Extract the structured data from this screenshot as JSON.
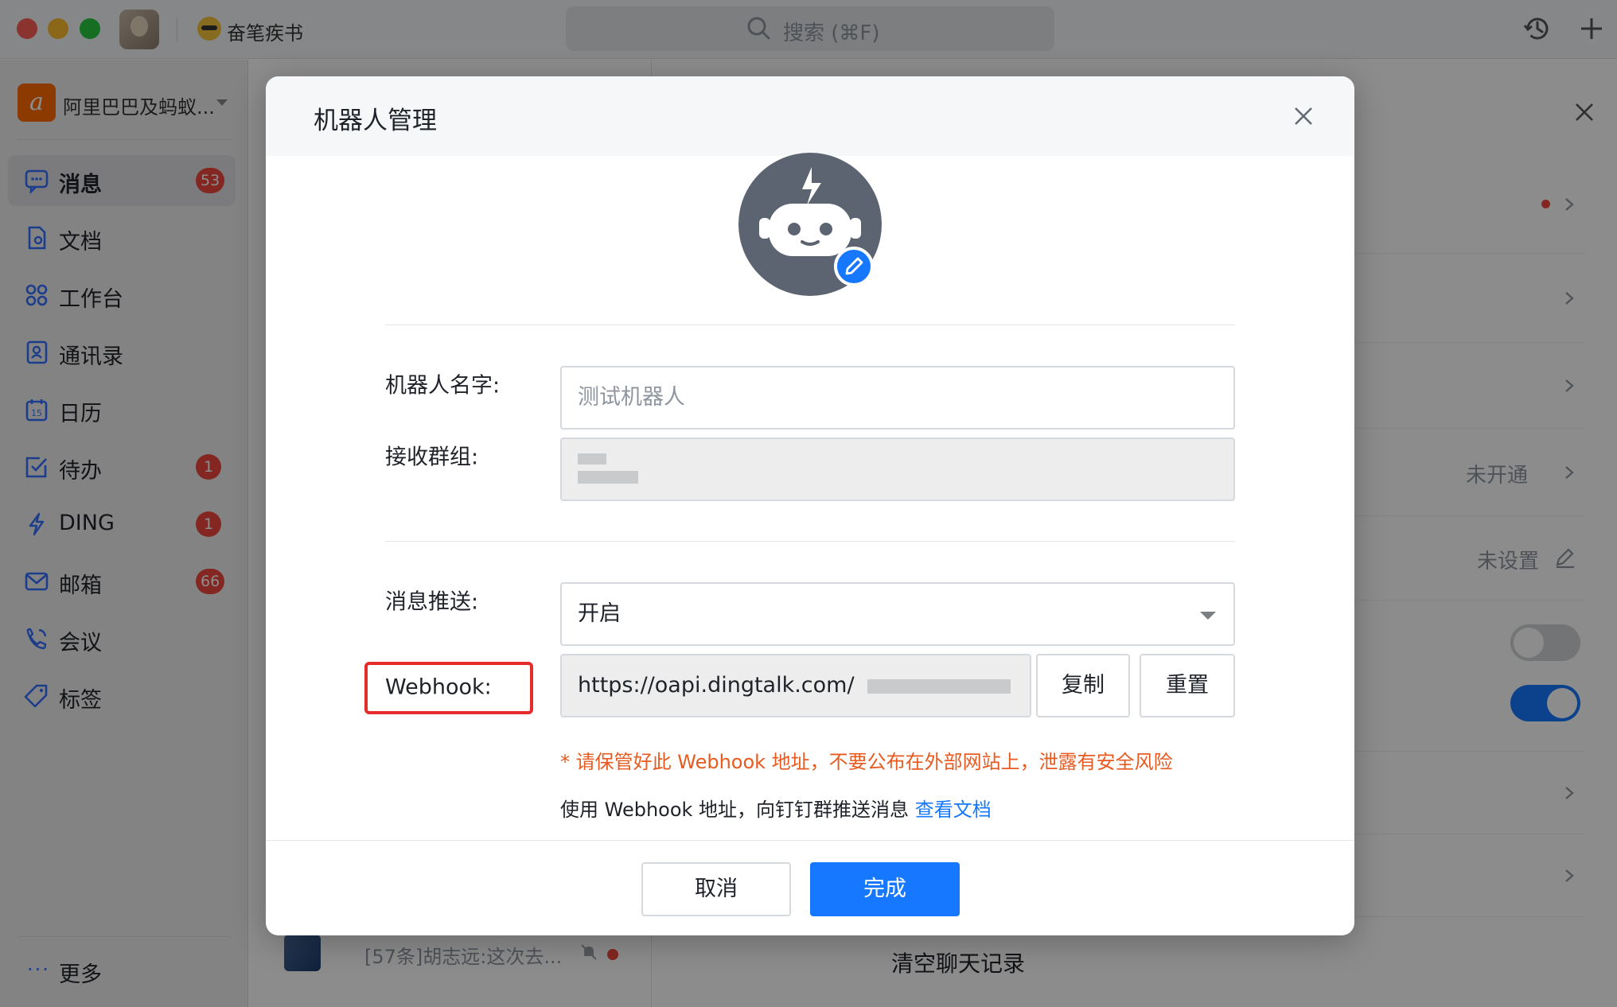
{
  "titlebar": {
    "status_text": "奋笔疾书",
    "search_placeholder": "搜索 (⌘F)"
  },
  "sidebar": {
    "org_name": "阿里巴巴及蚂蚁...",
    "org_logo_text": "a",
    "items": [
      {
        "label": "消息",
        "badge": "53",
        "icon": "message-icon",
        "active": true
      },
      {
        "label": "文档",
        "badge": "",
        "icon": "document-icon"
      },
      {
        "label": "工作台",
        "badge": "",
        "icon": "workbench-icon"
      },
      {
        "label": "通讯录",
        "badge": "",
        "icon": "contacts-icon"
      },
      {
        "label": "日历",
        "badge": "",
        "icon": "calendar-icon",
        "calendar_day": "15"
      },
      {
        "label": "待办",
        "badge": "1",
        "icon": "todo-icon"
      },
      {
        "label": "DING",
        "badge": "1",
        "icon": "ding-icon"
      },
      {
        "label": "邮箱",
        "badge": "66",
        "icon": "mail-icon"
      },
      {
        "label": "会议",
        "badge": "",
        "icon": "meeting-icon"
      },
      {
        "label": "标签",
        "badge": "",
        "icon": "tag-icon"
      }
    ],
    "more_dots": "···",
    "more_label": "更多"
  },
  "chat_list": {
    "visible_row_text": "[57条]胡志远:这次去..."
  },
  "settings_panel": {
    "rows": [
      {
        "value": "",
        "has_dot": true
      },
      {
        "value": ""
      },
      {
        "value": ""
      },
      {
        "value": "未开通"
      },
      {
        "value": "未设置"
      }
    ],
    "toggles": [
      {
        "state": "off"
      },
      {
        "state": "on"
      }
    ],
    "clear_history_label": "清空聊天记录"
  },
  "modal": {
    "title": "机器人管理",
    "name_label": "机器人名字:",
    "name_placeholder": "测试机器人",
    "group_label": "接收群组:",
    "push_label": "消息推送:",
    "push_value": "开启",
    "webhook_label": "Webhook:",
    "webhook_value": "https://oapi.dingtalk.com/",
    "copy_button": "复制",
    "reset_button": "重置",
    "warning": "* 请保管好此 Webhook 地址，不要公布在外部网站上，泄露有安全风险",
    "help_text": "使用 Webhook 地址，向钉钉群推送消息",
    "help_link": "查看文档",
    "cancel_button": "取消",
    "done_button": "完成"
  },
  "colors": {
    "accent": "#1677ff",
    "badge_red": "#f0483e",
    "warning_orange": "#e85a1f",
    "highlight_red": "#e62b2b"
  }
}
